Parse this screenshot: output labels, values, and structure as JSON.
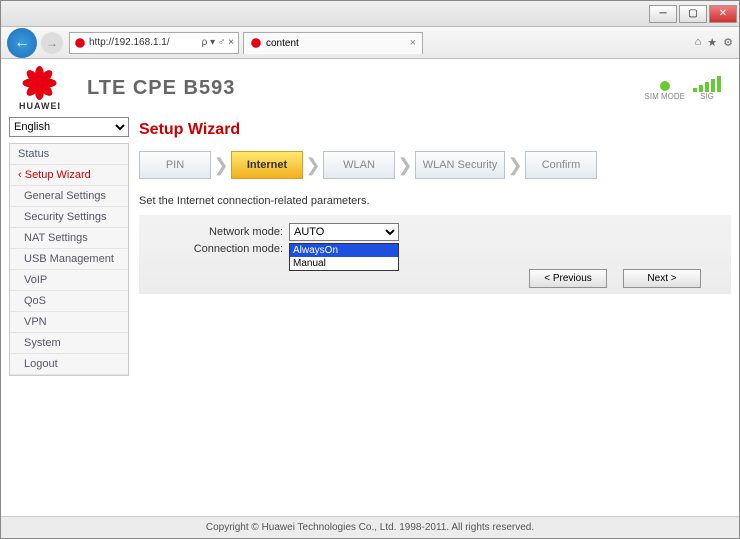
{
  "browser": {
    "url": "http://192.168.1.1/",
    "url_suffix": "ρ ▾ ♂ ×",
    "tab_title": "content"
  },
  "header": {
    "brand": "HUAWEI",
    "device": "LTE CPE B593",
    "sim_label": "SIM MODE",
    "sig_label": "SIG"
  },
  "language": "English",
  "nav": {
    "items": [
      "Status",
      "Setup Wizard",
      "General Settings",
      "Security Settings",
      "NAT Settings",
      "USB Management",
      "VoIP",
      "QoS",
      "VPN",
      "System",
      "Logout"
    ],
    "active_index": 1
  },
  "panel": {
    "title": "Setup Wizard",
    "steps": [
      "PIN",
      "Internet",
      "WLAN",
      "WLAN Security",
      "Confirm"
    ],
    "active_step": 1,
    "instruction": "Set the Internet connection-related parameters.",
    "network_mode_label": "Network mode:",
    "network_mode_value": "AUTO",
    "connection_mode_label": "Connection mode:",
    "connection_options": [
      "AlwaysOn",
      "Manual"
    ],
    "prev_btn": "< Previous",
    "next_btn": "Next >"
  },
  "footer": "Copyright © Huawei Technologies Co., Ltd. 1998-2011. All rights reserved."
}
